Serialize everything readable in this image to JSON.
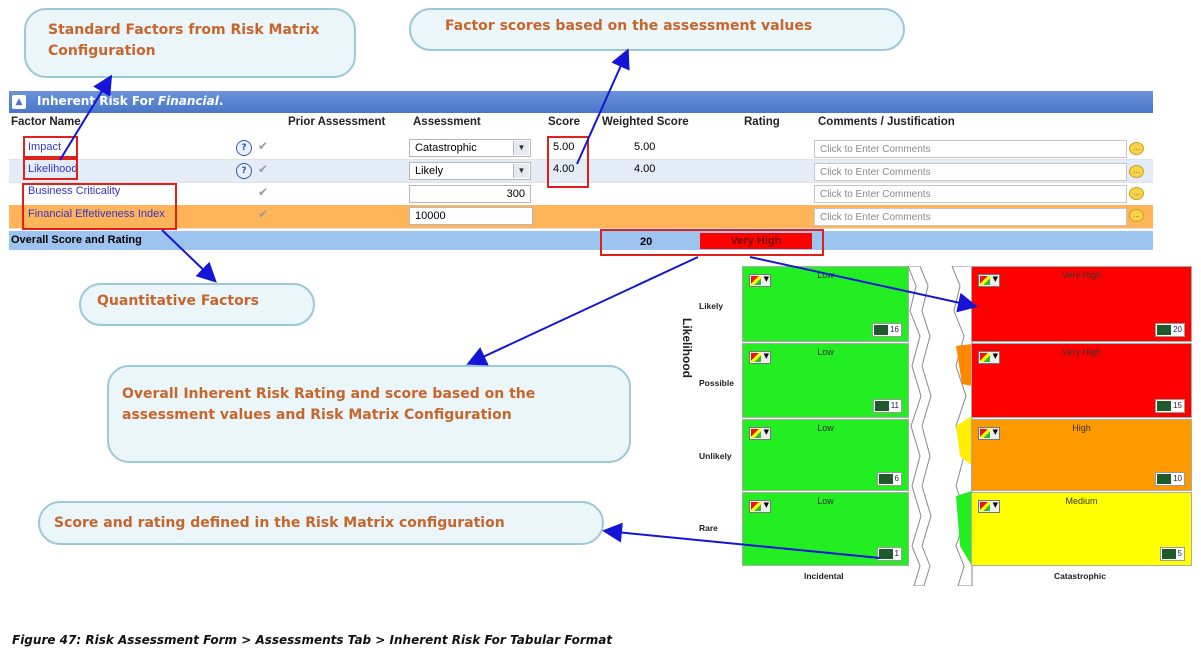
{
  "callouts": {
    "standard_factors": "Standard Factors from Risk Matrix Configuration",
    "factor_scores": "Factor scores based on the assessment values",
    "quantitative": "Quantitative Factors",
    "overall": "Overall Inherent Risk Rating and score based on the assessment values and Risk Matrix Configuration",
    "score_rating": "Score and rating defined in the Risk Matrix configuration"
  },
  "panel": {
    "title_prefix": "Inherent Risk For",
    "title_entity": "Financial",
    "title_suffix": "."
  },
  "columns": {
    "factor_name": "Factor Name",
    "prior_assessment": "Prior Assessment",
    "assessment": "Assessment",
    "score": "Score",
    "weighted_score": "Weighted Score",
    "rating": "Rating",
    "comments": "Comments / Justification"
  },
  "rows": [
    {
      "name": "Impact",
      "assessment": "Catastrophic",
      "score": "5.00",
      "weighted": "5.00",
      "comment_placeholder": "Click to Enter Comments"
    },
    {
      "name": "Likelihood",
      "assessment": "Likely",
      "score": "4.00",
      "weighted": "4.00",
      "comment_placeholder": "Click to Enter Comments"
    },
    {
      "name": "Business Criticality",
      "assessment": "300",
      "comment_placeholder": "Click to Enter Comments"
    },
    {
      "name": "Financial Effetiveness Index",
      "assessment": "10000",
      "comment_placeholder": "Click to Enter Comments"
    }
  ],
  "overall": {
    "label": "Overall Score and Rating",
    "score": "20",
    "rating": "Very High"
  },
  "matrix": {
    "axis_title": "Likelihood",
    "row_labels": [
      "Likely",
      "Possible",
      "Unlikely",
      "Rare"
    ],
    "col_labels": [
      "Incidental",
      "Catastrophic"
    ],
    "left_cells": [
      {
        "label": "Low",
        "score": "16"
      },
      {
        "label": "Low",
        "score": "11"
      },
      {
        "label": "Low",
        "score": "6"
      },
      {
        "label": "Low",
        "score": "1"
      }
    ],
    "right_cells": [
      {
        "label": "Very High",
        "score": "20",
        "color": "#ff0000"
      },
      {
        "label": "Very High",
        "score": "15",
        "color": "#ff0000"
      },
      {
        "label": "High",
        "score": "10",
        "color": "#ff9900"
      },
      {
        "label": "Medium",
        "score": "5",
        "color": "#ffff00"
      }
    ]
  },
  "colors": {
    "header_blue": "#4a76c8",
    "orange_row": "#ffb45a",
    "overall_row": "#9dc3ef",
    "very_high": "#ff0000",
    "low_green": "#22ee22"
  },
  "caption": "Figure 47: Risk Assessment Form > Assessments Tab > Inherent Risk For Tabular Format"
}
